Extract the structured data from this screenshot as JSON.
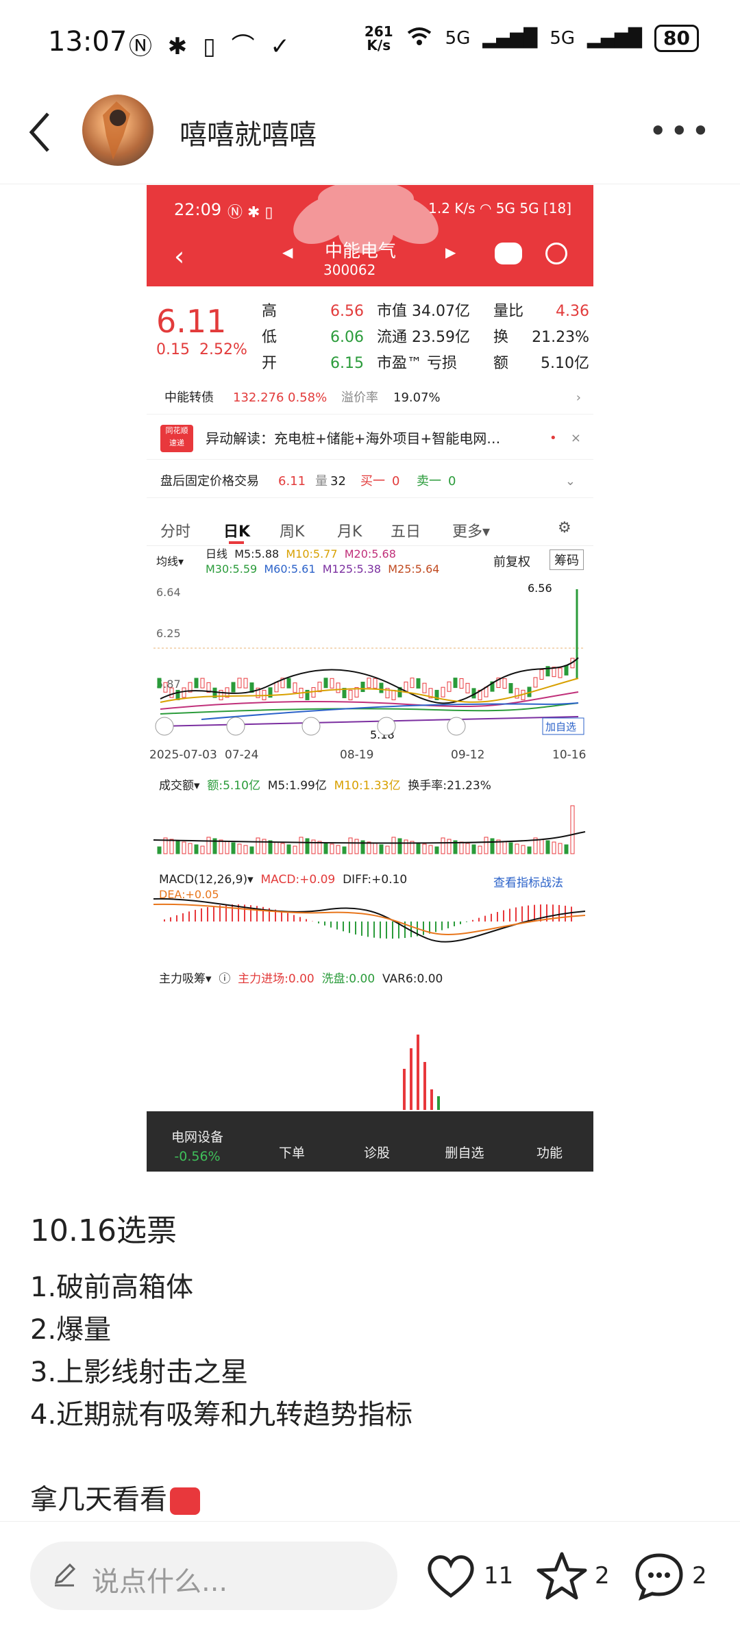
{
  "status_bar": {
    "time": "13:07",
    "net_speed_value": "261",
    "net_speed_unit": "K/s",
    "signal1": "5G",
    "signal2": "5G",
    "battery": "80"
  },
  "header": {
    "username": "嘻嘻就嘻嘻"
  },
  "embedded_screenshot": {
    "status_time": "22:09",
    "status_speed": "1.2 K/s",
    "battery": "18",
    "stock_name": "中能电气",
    "stock_code": "300062",
    "price": "6.11",
    "change": "0.15",
    "change_pct": "2.52%",
    "quote": {
      "high_label": "高",
      "high": "6.56",
      "low_label": "低",
      "low": "6.06",
      "open_label": "开",
      "open": "6.15",
      "mcap_label": "市值",
      "mcap": "34.07亿",
      "float_label": "流通",
      "float": "23.59亿",
      "pe_label": "市盈™",
      "pe": "亏损",
      "vr_label": "量比",
      "vr": "4.36",
      "turn_label": "换",
      "turn": "21.23%",
      "amt_label": "额",
      "amt": "5.10亿"
    },
    "bond": {
      "name": "中能转债",
      "price": "132.276",
      "pct": "0.58%",
      "premium_label": "溢价率",
      "premium": "19.07%"
    },
    "alert": {
      "badge_top": "同花顺",
      "badge_bottom": "速递",
      "text": "异动解读：充电桩+储能+海外项目+智能电网…"
    },
    "after_hours": {
      "label": "盘后固定价格交易",
      "price": "6.11",
      "vol_label": "量",
      "vol": "32",
      "buy_label": "买一",
      "buy": "0",
      "sell_label": "卖一",
      "sell": "0"
    },
    "tabs": [
      "分时",
      "日K",
      "周K",
      "月K",
      "五日",
      "更多▾"
    ],
    "ma_legend": {
      "selector": "均线▾",
      "line": "日线",
      "m5": "M5:5.88",
      "m10": "M10:5.77",
      "m20": "M20:5.68",
      "m30": "M30:5.59",
      "m60": "M60:5.61",
      "m125": "M125:5.38",
      "m25": "M25:5.64",
      "fq": "前复权",
      "chip": "筹码"
    },
    "price_axis": [
      "6.64",
      "6.25",
      "5.87"
    ],
    "max_label": "6.56",
    "min_label": "5.18",
    "add_fav": "加自选",
    "dates": [
      "2025-07-03",
      "07-24",
      "08-19",
      "09-12",
      "10-16"
    ],
    "volume_legend": {
      "sel": "成交额▾",
      "amt": "额:5.10亿",
      "m5": "M5:1.99亿",
      "m10": "M10:1.33亿",
      "turn": "换手率:21.23%"
    },
    "macd_legend": {
      "sel": "MACD(12,26,9)▾",
      "macd": "MACD:+0.09",
      "diff": "DIFF:+0.10",
      "dea": "DEA:+0.05",
      "link": "查看指标战法"
    },
    "chip_legend": {
      "sel": "主力吸筹▾",
      "inflow": "主力进场:0.00",
      "wash": "洗盘:0.00",
      "var6": "VAR6:0.00"
    },
    "bottom_bar": {
      "sector": "电网设备",
      "sector_pct": "-0.56%",
      "b1": "下单",
      "b2": "诊股",
      "b3": "删自选",
      "b4": "功能"
    }
  },
  "post": {
    "title": "10.16选票",
    "items": [
      "1.破前高箱体",
      "2.爆量",
      "3.上影线射击之星",
      "4.近期就有吸筹和九转趋势指标"
    ],
    "closing": "拿几天看看"
  },
  "actions": {
    "comment_placeholder": "说点什么...",
    "likes": "11",
    "favorites": "2",
    "comments": "2"
  },
  "colors": {
    "red": "#e8383c",
    "green": "#2a9b3a"
  }
}
